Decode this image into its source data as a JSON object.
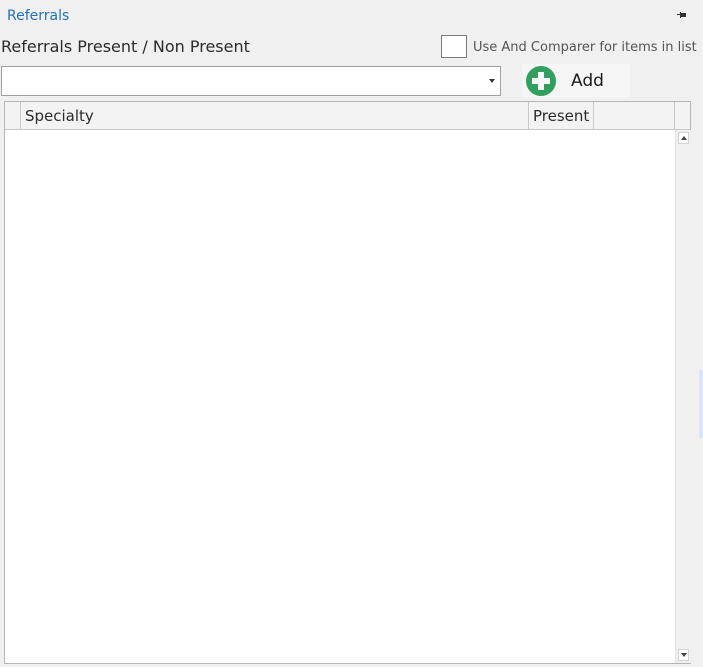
{
  "panel": {
    "title": "Referrals"
  },
  "section": {
    "heading": "Referrals Present / Non Present"
  },
  "compare": {
    "label": "Use And Comparer for items in list",
    "checked": false
  },
  "dropdown": {
    "value": ""
  },
  "add_button": {
    "label": "Add"
  },
  "grid": {
    "columns": [
      "",
      "Specialty",
      "Present",
      ""
    ],
    "rows": []
  },
  "colors": {
    "accent": "#1e73be",
    "add_icon": "#2fa05d"
  }
}
